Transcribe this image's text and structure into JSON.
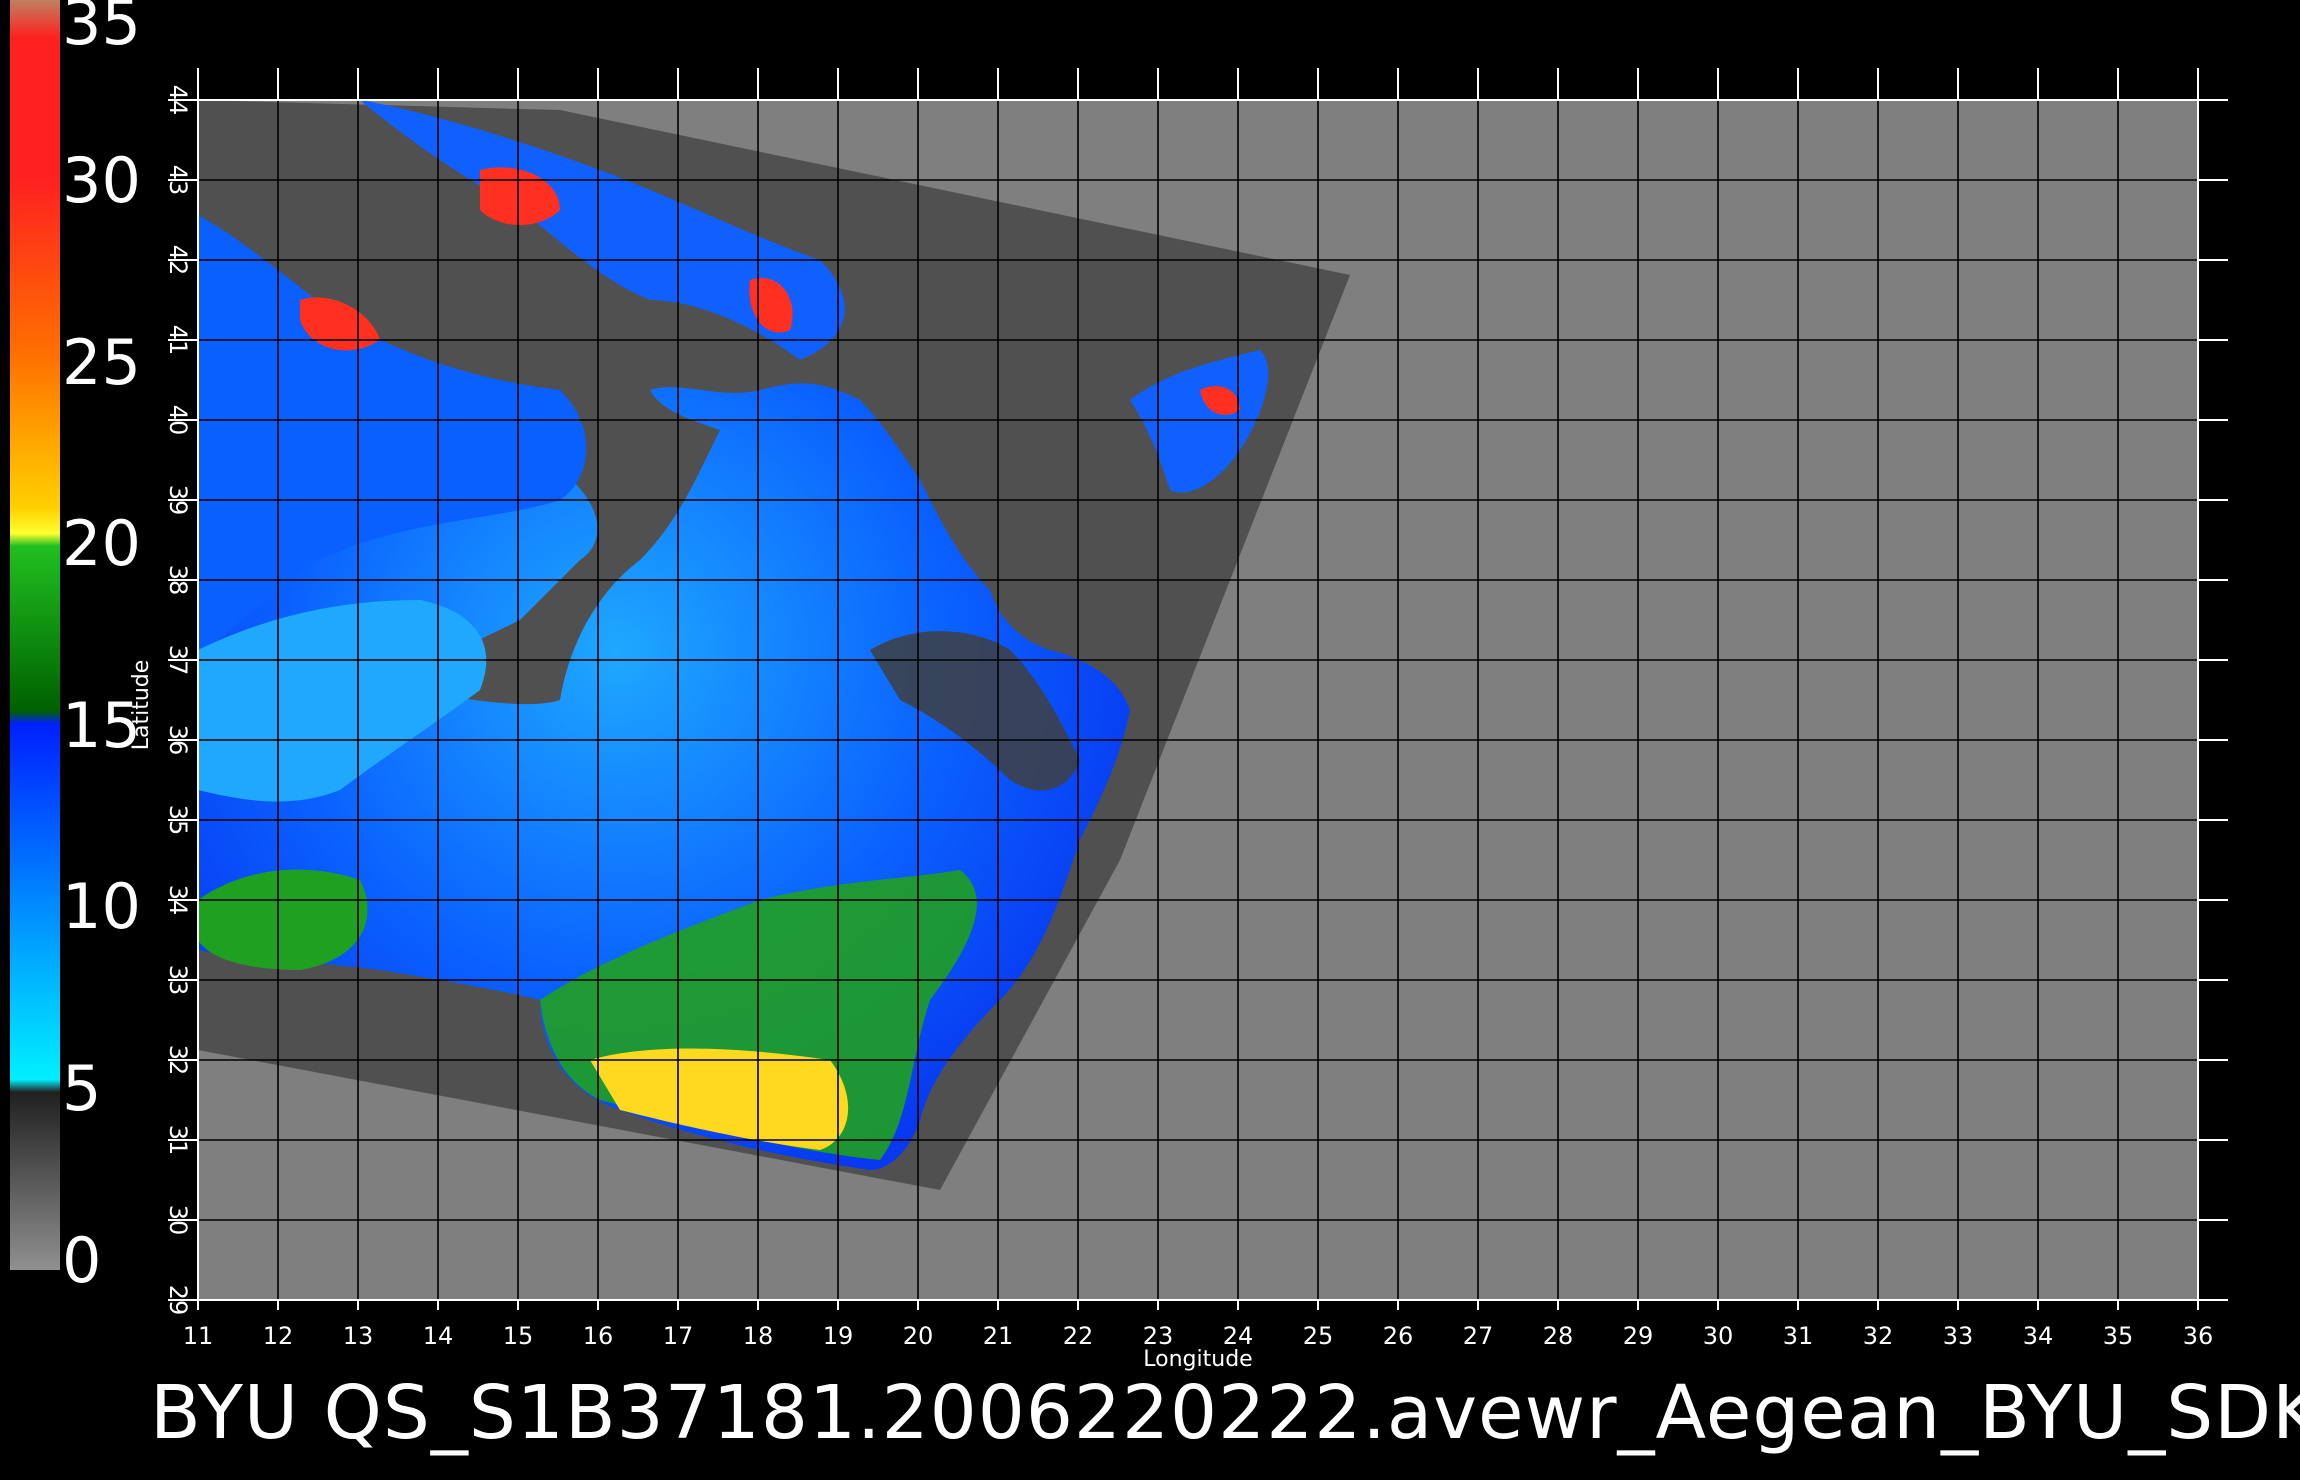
{
  "map": {
    "x_axis": {
      "label": "Longitude",
      "min": 11,
      "max": 36,
      "ticks": [
        "11",
        "12",
        "13",
        "14",
        "15",
        "16",
        "17",
        "18",
        "19",
        "20",
        "21",
        "22",
        "23",
        "24",
        "25",
        "26",
        "27",
        "28",
        "29",
        "30",
        "31",
        "32",
        "33",
        "34",
        "35",
        "36"
      ]
    },
    "y_axis": {
      "label": "Latitude",
      "min": 29,
      "max": 44,
      "ticks": [
        "29",
        "30",
        "31",
        "32",
        "33",
        "34",
        "35",
        "36",
        "37",
        "38",
        "39",
        "40",
        "41",
        "42",
        "43",
        "44"
      ]
    },
    "background_color": "#7f7f7f",
    "swath_color": "#505050",
    "grid": true
  },
  "colorbar": {
    "labels": [
      "35",
      "30",
      "25",
      "20",
      "15",
      "10",
      "5",
      "0"
    ],
    "min": 0,
    "max": 35,
    "colors": [
      "#c08060",
      "#ff2020",
      "#ff5010",
      "#ffb000",
      "#ffff30",
      "#10b010",
      "#0030ff",
      "#00d8ff",
      "#404040",
      "#808080"
    ]
  },
  "caption": "BYU  QS_S1B37181.2006220222.avewr_Aegean_BYU_SDK"
}
